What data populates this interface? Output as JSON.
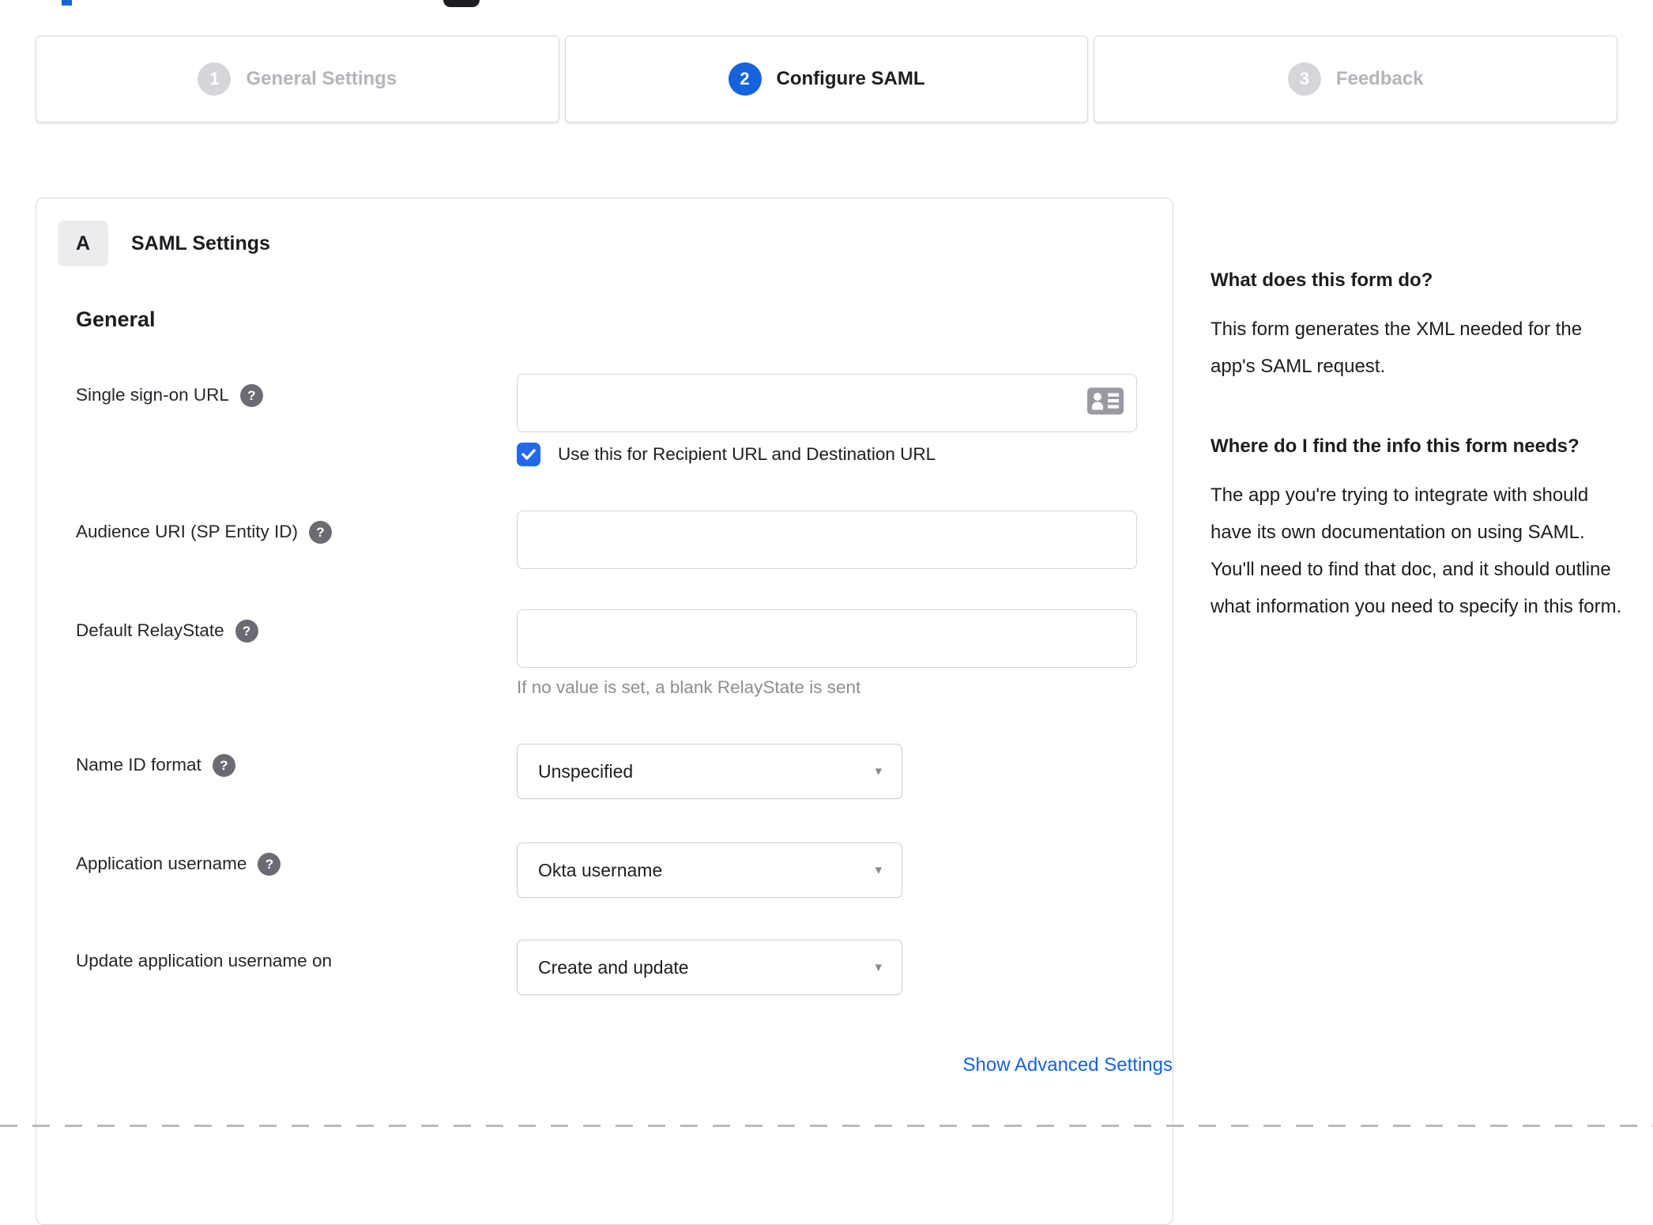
{
  "stepper": {
    "steps": [
      {
        "number": "1",
        "label": "General Settings",
        "state": "inactive"
      },
      {
        "number": "2",
        "label": "Configure SAML",
        "state": "active"
      },
      {
        "number": "3",
        "label": "Feedback",
        "state": "inactive"
      }
    ]
  },
  "panel": {
    "badge": "A",
    "title": "SAML Settings",
    "section_heading": "General",
    "fields": [
      {
        "label": "Single sign-on URL",
        "has_help": true,
        "type": "text",
        "value": "",
        "checkbox": {
          "checked": true,
          "label": "Use this for Recipient URL and Destination URL"
        }
      },
      {
        "label": "Audience URI (SP Entity ID)",
        "has_help": true,
        "type": "text",
        "value": ""
      },
      {
        "label": "Default RelayState",
        "has_help": true,
        "type": "text",
        "value": "",
        "helper": "If no value is set, a blank RelayState is sent"
      },
      {
        "label": "Name ID format",
        "has_help": true,
        "type": "select",
        "value": "Unspecified"
      },
      {
        "label": "Application username",
        "has_help": true,
        "type": "select",
        "value": "Okta username"
      },
      {
        "label": "Update application username on",
        "has_help": false,
        "type": "select",
        "value": "Create and update"
      }
    ],
    "help_icon_glyph": "?",
    "advanced_link": "Show Advanced Settings"
  },
  "help_sidebar": {
    "sections": [
      {
        "heading": "What does this form do?",
        "body": "This form generates the XML needed for the app's SAML request."
      },
      {
        "heading": "Where do I find the info this form needs?",
        "body": "The app you're trying to integrate with should have its own documentation on using SAML. You'll need to find that doc, and it should outline what information you need to specify in this form."
      }
    ]
  },
  "colors": {
    "accent_blue": "#1662dd",
    "checkbox_blue": "#2368e9",
    "link_blue": "#1662dd",
    "inactive_gray": "#d6d6da",
    "text_dark": "#1d1d21",
    "helper_gray": "#8d8d95"
  }
}
